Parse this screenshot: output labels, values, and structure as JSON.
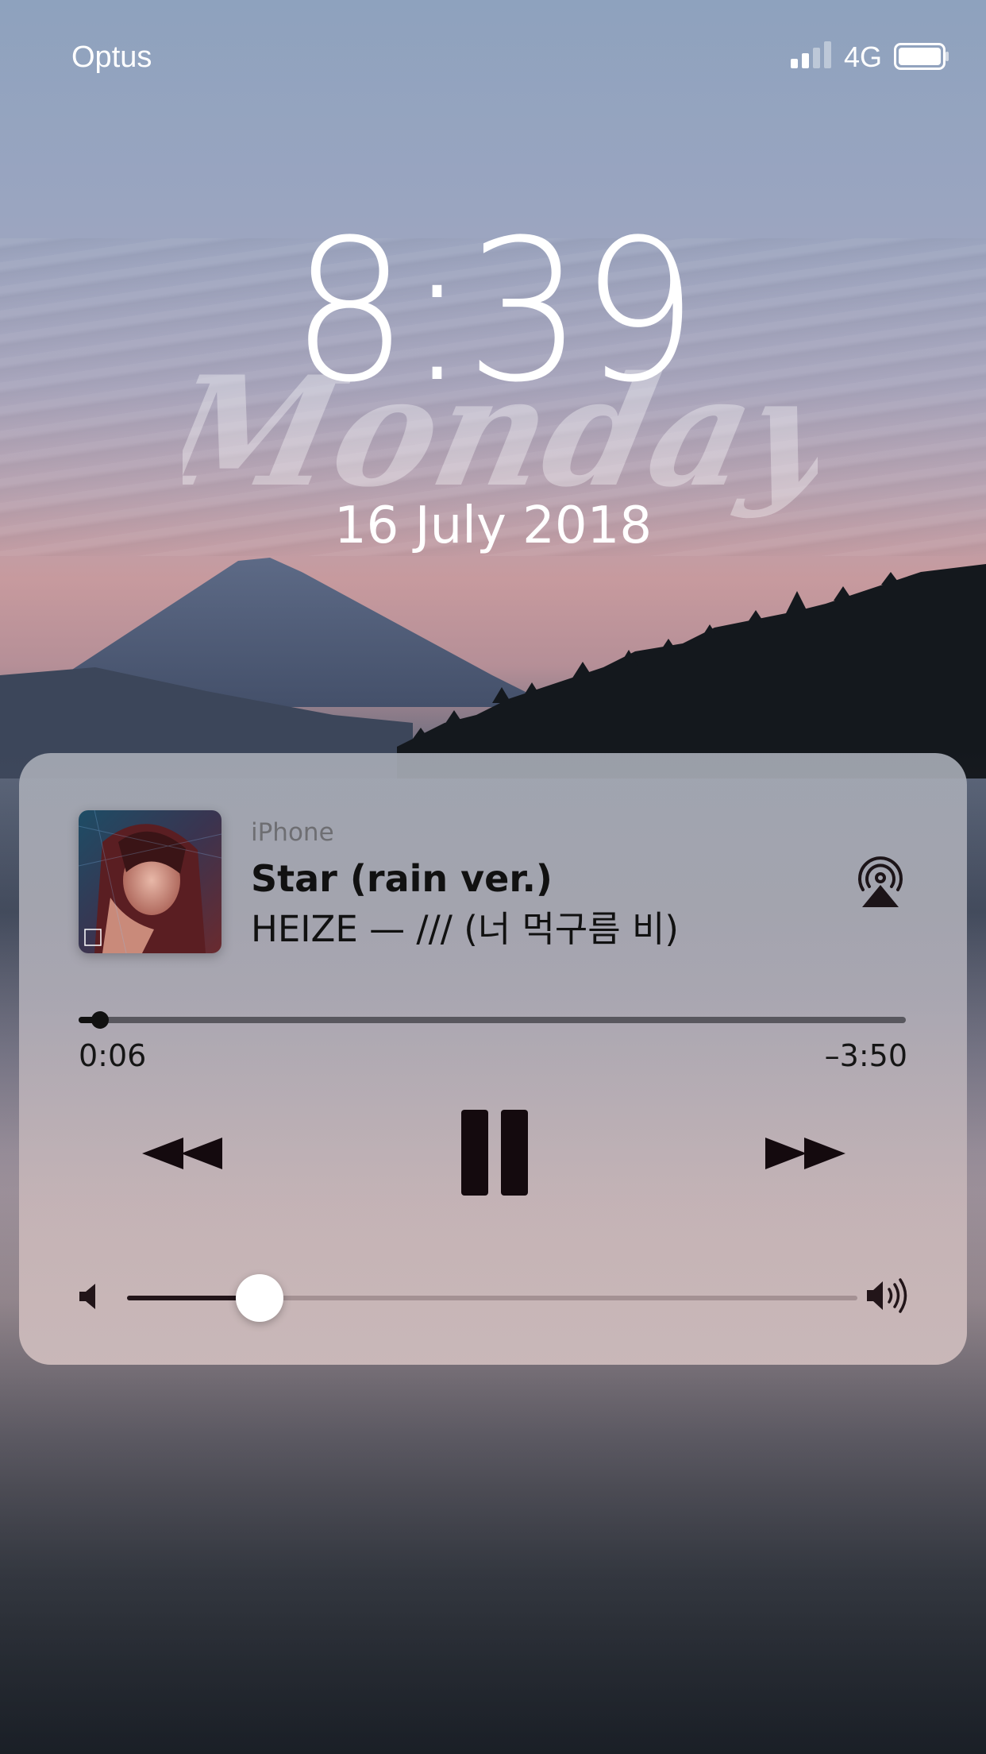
{
  "status_bar": {
    "carrier": "Optus",
    "network": "4G",
    "signal_bars_filled": 2,
    "signal_bars_total": 4,
    "battery_level": 1.0
  },
  "lock_screen": {
    "time": "8:39",
    "weekday": "Monday",
    "date": "16 July 2018"
  },
  "now_playing": {
    "source": "iPhone",
    "title": "Star (rain ver.)",
    "artist_album": "HEIZE — /// (너 먹구름 비)",
    "elapsed": "0:06",
    "remaining": "–3:50",
    "progress": 0.026,
    "volume": 0.16,
    "is_playing": true
  },
  "icons": {
    "airplay": "airplay-icon",
    "rewind": "rewind-icon",
    "pause": "pause-icon",
    "forward": "fast-forward-icon",
    "volume_low": "volume-low-icon",
    "volume_high": "volume-high-icon",
    "signal": "cellular-signal-icon",
    "battery": "battery-icon"
  },
  "colors": {
    "controls": "#140a0e",
    "card_top": "#a5aab4",
    "card_bottom": "#cebcbc"
  }
}
